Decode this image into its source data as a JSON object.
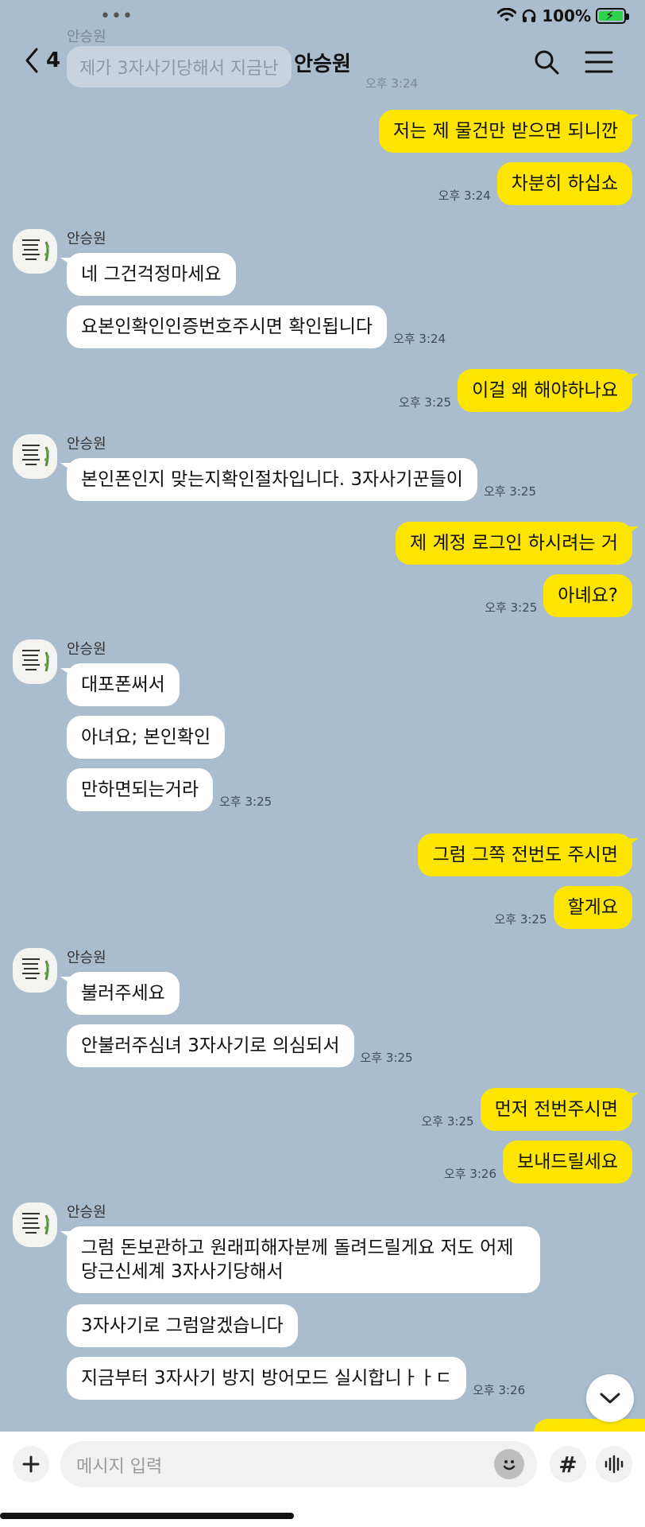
{
  "status": {
    "battery": "100%"
  },
  "header": {
    "back_count": "4",
    "title": "안승원"
  },
  "ghost": {
    "name": "안승원",
    "text": "제가 3자사기당해서 지금난",
    "time": "오후 3:24"
  },
  "messages": {
    "m1": "저는 제 물건만 받으면 되니깐",
    "m2": "차분히 하십쇼",
    "t2": "오후 3:24",
    "n3": "안승원",
    "m3": "네 그건걱정마세요",
    "m4": "요본인확인인증번호주시면 확인됩니다",
    "t4": "오후 3:24",
    "m5": "이걸 왜 해야하나요",
    "t5": "오후 3:25",
    "n6": "안승원",
    "m6": "본인폰인지 맞는지확인절차입니다. 3자사기꾼들이",
    "t6": "오후 3:25",
    "m7": "제 계정 로그인 하시려는 거",
    "m8": "아녜요?",
    "t8": "오후 3:25",
    "n9": "안승원",
    "m9": "대포폰써서",
    "m10": "아녀요; 본인확인",
    "m11": "만하면되는거라",
    "t11": "오후 3:25",
    "m12": "그럼 그쪽 전번도 주시면",
    "m13": "할게요",
    "t13": "오후 3:25",
    "n14": "안승원",
    "m14": "불러주세요",
    "m15": "안불러주심녀 3자사기로 의심되서",
    "t15": "오후 3:25",
    "m16": "먼저 전번주시면",
    "t16": "오후 3:25",
    "m17": "보내드릴세요",
    "t17": "오후 3:26",
    "n18": "안승원",
    "m18": "그럼 돈보관하고 원래피해자분께 돌려드릴게요 저도 어제 당근신세계 3자사기당해서",
    "m19": "3자사기로 그럼알겠습니다",
    "m20": "지금부터 3자사기 방지 방어모드 실시합니ㅏㅏㄷ",
    "t20": "오후 3:26"
  },
  "input": {
    "placeholder": "메시지 입력"
  },
  "icons": {
    "back": "chevron-left-icon",
    "search": "search-icon",
    "menu": "hamburger-menu-icon",
    "plus": "plus-icon",
    "emoji": "emoji-icon",
    "hash": "hashtag-icon",
    "voice": "voice-wave-icon",
    "scroll": "chevron-down-icon"
  },
  "colors": {
    "background": "#a9bdce",
    "my_bubble": "#fee500",
    "their_bubble": "#ffffff"
  }
}
